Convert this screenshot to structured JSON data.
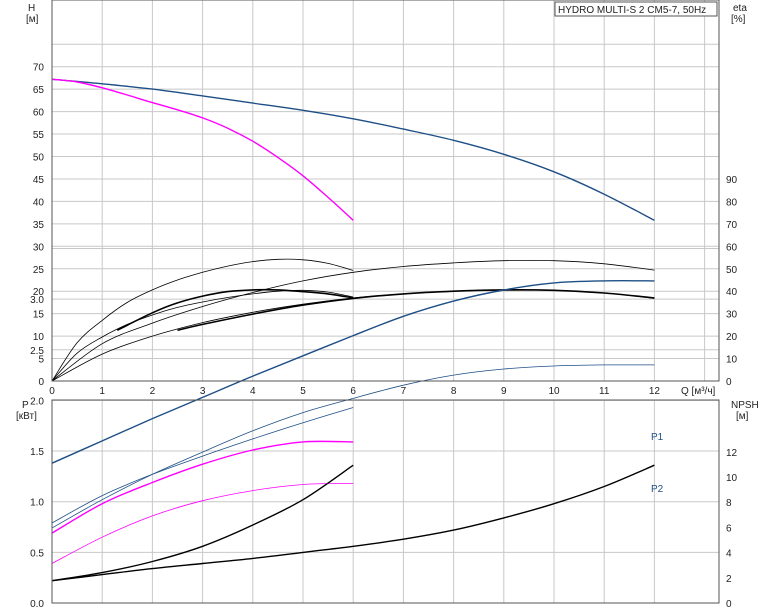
{
  "title": "HYDRO MULTI-S 2 CM5-7, 50Hz",
  "chart_data": [
    {
      "type": "line",
      "left_axis": {
        "label": "H",
        "unit": "[м]",
        "ticks": [
          0,
          5,
          10,
          15,
          20,
          25,
          30,
          35,
          40,
          45,
          50,
          55,
          60,
          65,
          70
        ],
        "ylim": [
          0,
          78
        ]
      },
      "right_axis": {
        "label": "eta",
        "unit": "[%]",
        "ticks": [
          0,
          10,
          20,
          30,
          40,
          50,
          60,
          70,
          80,
          90
        ]
      },
      "x_axis": {
        "label": "Q [м³/ч]",
        "ticks": [
          0,
          1,
          2,
          3,
          4,
          5,
          6,
          7,
          8,
          9,
          10,
          11,
          12
        ],
        "xlim": [
          0,
          13
        ]
      },
      "series": [
        {
          "color": "#1e4f86",
          "axis": "left",
          "width": 1.4,
          "x": [
            0,
            1,
            2,
            3,
            4,
            5,
            6,
            7,
            8,
            9,
            10,
            11,
            12
          ],
          "y": [
            67.2,
            66.2,
            65,
            63.5,
            61.9,
            60.3,
            58.4,
            56.1,
            53.6,
            50.5,
            46.6,
            41.6,
            35.8
          ]
        },
        {
          "color": "#ff00ff",
          "axis": "left",
          "width": 1.4,
          "x": [
            0,
            0.5,
            1,
            1.5,
            2,
            2.5,
            3,
            3.5,
            4,
            4.5,
            5,
            5.5,
            6
          ],
          "y": [
            67.2,
            66.6,
            65.3,
            63.7,
            62,
            60.4,
            58.6,
            56.3,
            53.4,
            49.8,
            45.7,
            40.9,
            35.8
          ]
        },
        {
          "color": "#000000",
          "axis": "left",
          "width": 0.8,
          "x": [
            0,
            0.5,
            1,
            1.5,
            2,
            2.5,
            3,
            3.5,
            4,
            4.5,
            5,
            5.5,
            6
          ],
          "y": [
            0,
            8.5,
            13.5,
            17.5,
            20.3,
            22.5,
            24.2,
            25.6,
            26.6,
            27.1,
            27,
            26.2,
            24.6
          ]
        },
        {
          "color": "#000000",
          "axis": "left",
          "width": 0.8,
          "x": [
            0,
            1,
            2,
            3,
            4,
            5,
            6,
            7,
            8,
            9,
            10,
            11,
            12
          ],
          "y": [
            0,
            8.3,
            12.9,
            16.6,
            19.7,
            22.3,
            24.2,
            25.5,
            26.3,
            26.8,
            26.8,
            26.1,
            24.7
          ]
        },
        {
          "color": "#000000",
          "axis": "left",
          "width": 1.6,
          "x": [
            1.3,
            2,
            2.5,
            3,
            3.5,
            4,
            4.5,
            5,
            5.5,
            6
          ],
          "y": [
            11.3,
            15.2,
            17.4,
            18.9,
            19.9,
            20.3,
            20.3,
            19.9,
            19.4,
            18.5
          ]
        },
        {
          "color": "#000000",
          "axis": "left",
          "width": 0.8,
          "x": [
            0,
            0.5,
            1,
            1.5,
            2,
            2.5,
            3,
            3.5,
            4,
            4.5,
            5,
            5.5,
            6
          ],
          "y": [
            0,
            6.2,
            9.8,
            12.6,
            14.7,
            16.4,
            17.6,
            18.6,
            19.4,
            20,
            20.2,
            19.8,
            18.7
          ]
        },
        {
          "color": "#000000",
          "axis": "left",
          "width": 1.6,
          "x": [
            2.5,
            3,
            4,
            5,
            6,
            7,
            8,
            9,
            10,
            11,
            12
          ],
          "y": [
            11.3,
            12.6,
            14.9,
            16.9,
            18.4,
            19.4,
            20,
            20.3,
            20.2,
            19.6,
            18.5
          ]
        },
        {
          "color": "#000000",
          "axis": "left",
          "width": 0.8,
          "x": [
            0,
            1,
            2,
            3,
            4,
            5,
            6,
            7,
            8,
            9,
            10,
            11,
            12
          ],
          "y": [
            0,
            6,
            10,
            13,
            15.3,
            17.1,
            18.5,
            19.4,
            20,
            20.2,
            20.2,
            19.6,
            18.4
          ]
        }
      ]
    },
    {
      "type": "line",
      "left_axis": {
        "label": "P",
        "unit": "[кВт]",
        "ticks": [
          0.0,
          0.5,
          1.0,
          1.5,
          2.0,
          2.5,
          3.0
        ],
        "tick_labels": [
          "0.0",
          "0.5",
          "1.0",
          "1.5",
          "2.0",
          "2.5",
          "3.0"
        ],
        "ylim": [
          0,
          3.5
        ]
      },
      "right_axis": {
        "label": "NPSH",
        "unit": "[м]",
        "ticks": [
          0,
          2,
          4,
          6,
          8,
          10,
          12
        ],
        "ylim": [
          0,
          14
        ]
      },
      "x_axis": {
        "ticks": [
          0,
          1,
          2,
          3,
          4,
          5,
          6,
          7,
          8,
          9,
          10,
          11,
          12
        ],
        "xlim": [
          0,
          13
        ]
      },
      "series": [
        {
          "name": "P1",
          "color": "#1e4f86",
          "axis": "left",
          "width": 1.4,
          "x": [
            0,
            1,
            2,
            3,
            4,
            5,
            6,
            7,
            8,
            9,
            10,
            11,
            12
          ],
          "y": [
            1.38,
            1.6,
            1.82,
            2.03,
            2.24,
            2.44,
            2.64,
            2.83,
            2.98,
            3.09,
            3.16,
            3.18,
            3.18
          ]
        },
        {
          "name": "P2",
          "color": "#1e4f86",
          "axis": "left",
          "width": 0.8,
          "x": [
            0,
            1,
            2,
            3,
            4,
            5,
            6,
            7,
            8,
            9,
            10,
            11,
            12
          ],
          "y": [
            0.74,
            1.02,
            1.27,
            1.49,
            1.7,
            1.88,
            2.02,
            2.15,
            2.25,
            2.31,
            2.34,
            2.35,
            2.35
          ]
        },
        {
          "color": "#1e4f86",
          "axis": "left",
          "width": 0.8,
          "x": [
            0,
            1,
            2,
            3,
            4,
            5,
            6
          ],
          "y": [
            0.79,
            1.06,
            1.27,
            1.45,
            1.62,
            1.78,
            1.93
          ]
        },
        {
          "color": "#ff00ff",
          "axis": "left",
          "width": 1.4,
          "x": [
            0,
            1,
            2,
            3,
            4,
            5,
            6
          ],
          "y": [
            0.69,
            0.98,
            1.19,
            1.37,
            1.51,
            1.59,
            1.59
          ]
        },
        {
          "color": "#ff00ff",
          "axis": "left",
          "width": 0.8,
          "x": [
            0,
            1,
            2,
            3,
            4,
            5,
            6
          ],
          "y": [
            0.39,
            0.65,
            0.86,
            1.01,
            1.11,
            1.17,
            1.18
          ]
        },
        {
          "color": "#000000",
          "axis": "left",
          "width": 1.4,
          "x": [
            0,
            1,
            2,
            3,
            4,
            5,
            6
          ],
          "y": [
            0.22,
            0.3,
            0.41,
            0.56,
            0.77,
            1.02,
            1.36
          ]
        },
        {
          "color": "#000000",
          "axis": "left",
          "width": 1.4,
          "x": [
            0,
            1,
            2,
            3,
            4,
            5,
            6,
            7,
            8,
            9,
            10,
            11,
            12
          ],
          "y": [
            0.22,
            0.28,
            0.34,
            0.39,
            0.44,
            0.5,
            0.56,
            0.63,
            0.72,
            0.84,
            0.98,
            1.15,
            1.36
          ]
        }
      ]
    }
  ]
}
